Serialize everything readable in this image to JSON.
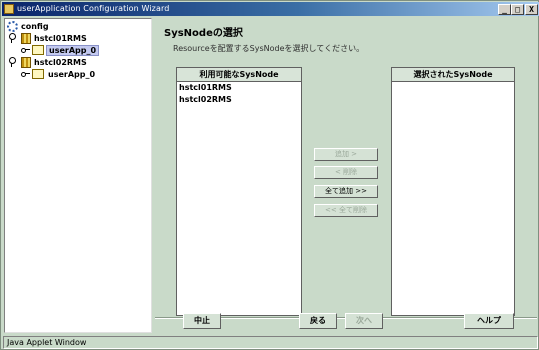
{
  "window": {
    "title": "userApplication Configuration Wizard",
    "controls": {
      "minimize": "_",
      "maximize": "□",
      "close": "X"
    }
  },
  "tree": {
    "root": {
      "label": "config",
      "icon": "config-root-icon"
    },
    "hosts": [
      {
        "label": "hstcl01RMS",
        "icon": "host-icon",
        "child": {
          "label": "userApp_0",
          "icon": "application-icon",
          "selected": true
        }
      },
      {
        "label": "hstcl02RMS",
        "icon": "host-icon",
        "child": {
          "label": "userApp_0",
          "icon": "application-icon",
          "selected": false
        }
      }
    ]
  },
  "main": {
    "heading": "SysNodeの選択",
    "instruction": "Resourceを配置するSysNodeを選択してください。",
    "available": {
      "header": "利用可能なSysNode",
      "items": [
        "hstcl01RMS",
        "hstcl02RMS"
      ]
    },
    "selected": {
      "header": "選択されたSysNode",
      "items": []
    },
    "transfer_buttons": {
      "add": "追加 >",
      "remove": "< 削除",
      "add_all": "全て追加 >>",
      "remove_all": "<< 全て削除"
    },
    "footer": {
      "cancel": "中止",
      "back": "戻る",
      "next": "次へ",
      "help": "ヘルプ"
    }
  },
  "status_bar": {
    "text": "Java Applet Window"
  }
}
